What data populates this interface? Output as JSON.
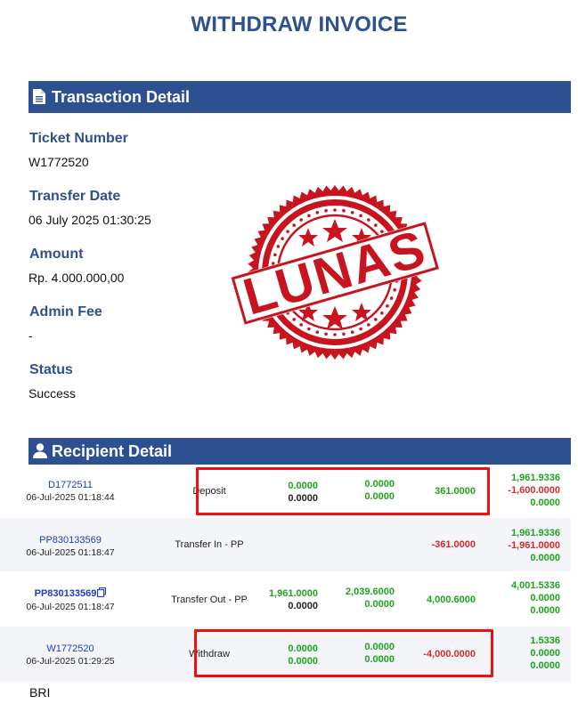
{
  "title": "WITHDRAW INVOICE",
  "transaction": {
    "header": "Transaction Detail",
    "header_icon": "document-icon",
    "fields": [
      {
        "label": "Ticket Number",
        "value": "W1772520"
      },
      {
        "label": "Transfer Date",
        "value": "06 July 2025 01:30:25"
      },
      {
        "label": "Amount",
        "value": "Rp. 4.000.000,00"
      },
      {
        "label": "Admin Fee",
        "value": "-"
      },
      {
        "label": "Status",
        "value": "Success"
      }
    ]
  },
  "stamp": {
    "text": "LUNAS",
    "color": "#c8141e"
  },
  "recipient": {
    "header": "Recipient Detail",
    "header_icon": "user-icon",
    "rows": [
      {
        "id": "D1772511",
        "date": "06-Jul-2025 01:18:44",
        "type": "Deposit",
        "c1": [
          "0.0000",
          "0.0000"
        ],
        "c2": [
          "0.0000",
          "0.0000"
        ],
        "c3": [
          "361.0000"
        ],
        "c4": [
          "1,961.9336",
          "-1,600.0000",
          "0.0000"
        ]
      },
      {
        "id": "PP830133569",
        "date": "06-Jul-2025 01:18:47",
        "type": "Transfer In - PP",
        "c1": [],
        "c2": [],
        "c3": [
          "-361.0000"
        ],
        "c4": [
          "1,961.9336",
          "-1,961.0000",
          "0.0000"
        ]
      },
      {
        "id": "PP830133569",
        "date": "06-Jul-2025 01:18:47",
        "type": "Transfer Out - PP",
        "c1": [
          "1,961.0000",
          "0.0000"
        ],
        "c2": [
          "2,039.6000",
          "0.0000"
        ],
        "c3": [
          "4,000.6000"
        ],
        "c4": [
          "4,001.5336",
          "0.0000",
          "0.0000"
        ]
      },
      {
        "id": "W1772520",
        "date": "06-Jul-2025 01:29:25",
        "type": "Withdraw",
        "c1": [
          "0.0000",
          "0.0000"
        ],
        "c2": [
          "0.0000",
          "0.0000"
        ],
        "c3": [
          "-4,000.0000"
        ],
        "c4": [
          "1.5336",
          "0.0000",
          "0.0000"
        ]
      }
    ]
  },
  "bank": "BRI",
  "colors": {
    "primary": "#2d5090",
    "positive": "#1ca51c",
    "negative": "#d42a2a",
    "highlight": "#ef1111"
  }
}
